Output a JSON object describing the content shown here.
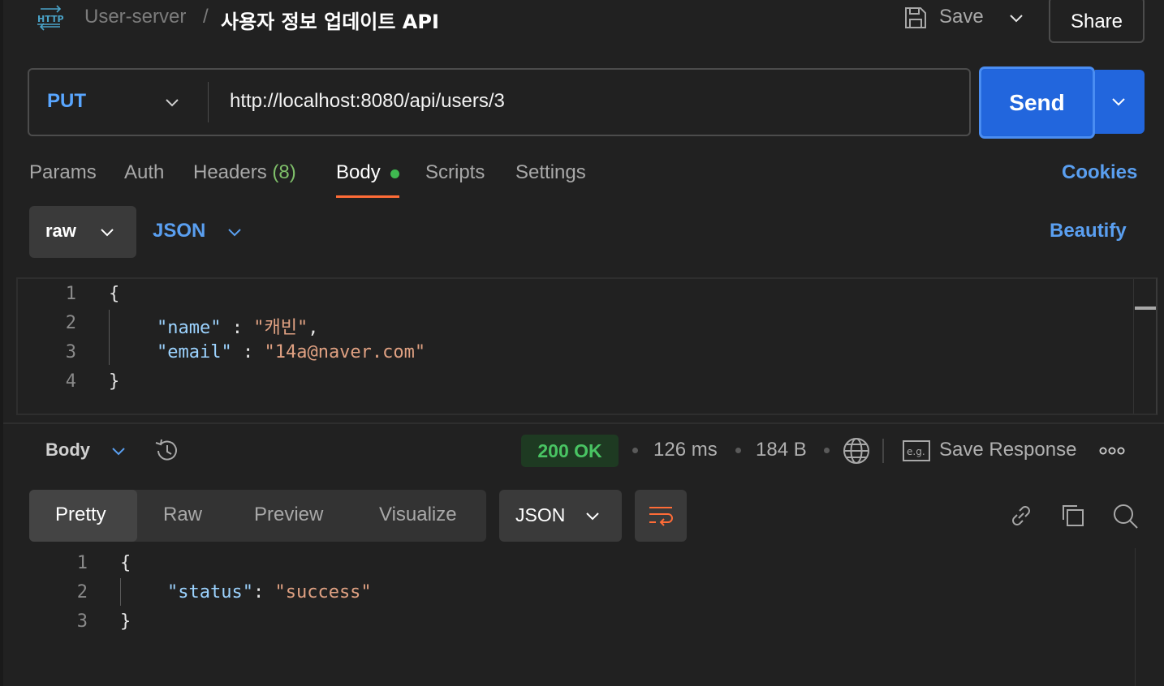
{
  "header": {
    "protocol_icon": "http-icon",
    "collection": "User-server",
    "separator": "/",
    "request_name": "사용자 정보 업데이트 API",
    "save_label": "Save",
    "share_label": "Share"
  },
  "request": {
    "method": "PUT",
    "url": "http://localhost:8080/api/users/3",
    "send_label": "Send"
  },
  "tabs": {
    "params": "Params",
    "auth": "Auth",
    "headers": "Headers",
    "headers_count": "(8)",
    "body": "Body",
    "scripts": "Scripts",
    "settings": "Settings",
    "active": "Body",
    "cookies": "Cookies"
  },
  "body_mode": {
    "mode": "raw",
    "language": "JSON",
    "beautify": "Beautify"
  },
  "request_body": {
    "line_numbers": [
      "1",
      "2",
      "3",
      "4"
    ],
    "open_brace": "{",
    "name_key": "\"name\"",
    "name_colon": " : ",
    "name_value": "\"캐빈\"",
    "name_comma": ",",
    "email_key": "\"email\"",
    "email_colon": " : ",
    "email_value": "\"14a@naver.com\"",
    "close_brace": "}"
  },
  "response": {
    "section_label": "Body",
    "status": "200 OK",
    "time": "126 ms",
    "size": "184 B",
    "save_response": "Save Response",
    "status_color": "#49c463",
    "view_tabs": [
      "Pretty",
      "Raw",
      "Preview",
      "Visualize"
    ],
    "active_view": "Pretty",
    "format": "JSON",
    "line_numbers": [
      "1",
      "2",
      "3"
    ],
    "open_brace": "{",
    "status_key": "\"status\"",
    "status_colon": ": ",
    "status_value": "\"success\"",
    "close_brace": "}"
  },
  "colors": {
    "accent_blue": "#2266dd",
    "link_blue": "#5a9ff0",
    "active_tab_underline": "#ff6c37",
    "body_dot": "#3fb950"
  }
}
